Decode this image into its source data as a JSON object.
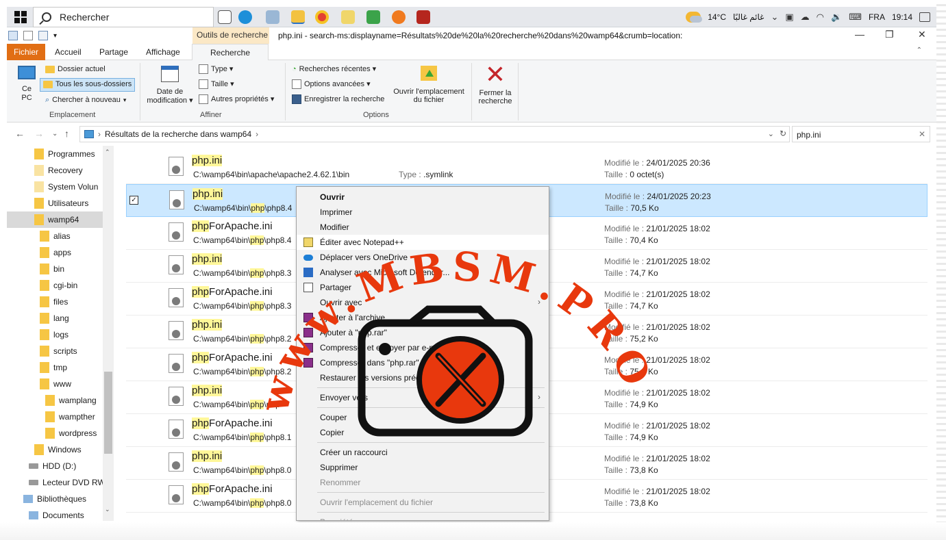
{
  "taskbar": {
    "search_placeholder": "Rechercher",
    "temperature": "14°C",
    "weather_text": "غائم غالبًا",
    "language": "FRA",
    "time": "19:14"
  },
  "titlebar": {
    "tools_tab": "Outils de recherche",
    "title": "php.ini - search-ms:displayname=Résultats%20de%20la%20recherche%20dans%20wamp64&crumb=location:"
  },
  "ribbon_tabs": [
    "Fichier",
    "Accueil",
    "Partage",
    "Affichage",
    "Recherche"
  ],
  "ribbon": {
    "this_pc": "Ce PC",
    "current_folder": "Dossier actuel",
    "all_subfolders": "Tous les sous-dossiers",
    "search_again": "Chercher à nouveau",
    "group_location": "Emplacement",
    "date_modified_1": "Date de",
    "date_modified_2": "modification",
    "type": "Type",
    "size": "Taille",
    "other_props": "Autres propriétés",
    "group_refine": "Affiner",
    "recent_searches": "Recherches récentes",
    "advanced_options": "Options avancées",
    "save_search": "Enregistrer la recherche",
    "open_location_1": "Ouvrir l'emplacement",
    "open_location_2": "du fichier",
    "group_options": "Options",
    "close_search_1": "Fermer la",
    "close_search_2": "recherche"
  },
  "address": {
    "path": "Résultats de la recherche dans wamp64",
    "search_value": "php.ini"
  },
  "nav": [
    {
      "label": "Programmes",
      "indent": 1,
      "kind": "folder"
    },
    {
      "label": "Recovery",
      "indent": 1,
      "kind": "pale"
    },
    {
      "label": "System Volun",
      "indent": 1,
      "kind": "pale"
    },
    {
      "label": "Utilisateurs",
      "indent": 1,
      "kind": "folder"
    },
    {
      "label": "wamp64",
      "indent": 1,
      "kind": "folder",
      "selected": true
    },
    {
      "label": "alias",
      "indent": 2,
      "kind": "folder"
    },
    {
      "label": "apps",
      "indent": 2,
      "kind": "folder"
    },
    {
      "label": "bin",
      "indent": 2,
      "kind": "folder"
    },
    {
      "label": "cgi-bin",
      "indent": 2,
      "kind": "folder"
    },
    {
      "label": "files",
      "indent": 2,
      "kind": "folder"
    },
    {
      "label": "lang",
      "indent": 2,
      "kind": "folder"
    },
    {
      "label": "logs",
      "indent": 2,
      "kind": "folder"
    },
    {
      "label": "scripts",
      "indent": 2,
      "kind": "folder"
    },
    {
      "label": "tmp",
      "indent": 2,
      "kind": "folder"
    },
    {
      "label": "www",
      "indent": 2,
      "kind": "folder"
    },
    {
      "label": "wamplang",
      "indent": 3,
      "kind": "folder"
    },
    {
      "label": "wampther",
      "indent": 3,
      "kind": "folder"
    },
    {
      "label": "wordpress",
      "indent": 3,
      "kind": "folder"
    },
    {
      "label": "Windows",
      "indent": 1,
      "kind": "folder"
    },
    {
      "label": "HDD (D:)",
      "indent": 0,
      "kind": "drive"
    },
    {
      "label": "Lecteur DVD RW",
      "indent": 0,
      "kind": "drive"
    },
    {
      "label": "Bibliothèques",
      "indent": -1,
      "kind": "lib"
    },
    {
      "label": "Documents",
      "indent": 0,
      "kind": "lib"
    }
  ],
  "labels": {
    "modified": "Modifié le : ",
    "size": "Taille : ",
    "type": "Type : "
  },
  "files": [
    {
      "name_hl": "php.ini",
      "name_rest": "",
      "path_a": "C:\\wamp64\\bin\\apache\\apache2.4.62.1\\bin",
      "path_php": "",
      "path_b": "",
      "type": ".symlink",
      "modified": "24/01/2025 20:36",
      "size": "0 octet(s)"
    },
    {
      "name_hl": "php.ini",
      "name_rest": "",
      "path_a": "C:\\wamp64\\bin\\",
      "path_php": "php",
      "path_b": "\\php8.4",
      "type": "",
      "modified": "24/01/2025 20:23",
      "size": "70,5 Ko",
      "selected": true
    },
    {
      "name_hl": "php",
      "name_rest": "ForApache.ini",
      "path_a": "C:\\wamp64\\bin\\",
      "path_php": "php",
      "path_b": "\\php8.4",
      "type": "",
      "modified": "21/01/2025 18:02",
      "size": "70,4 Ko"
    },
    {
      "name_hl": "php.ini",
      "name_rest": "",
      "path_a": "C:\\wamp64\\bin\\",
      "path_php": "php",
      "path_b": "\\php8.3",
      "type": "",
      "modified": "21/01/2025 18:02",
      "size": "74,7 Ko"
    },
    {
      "name_hl": "php",
      "name_rest": "ForApache.ini",
      "path_a": "C:\\wamp64\\bin\\",
      "path_php": "php",
      "path_b": "\\php8.3",
      "type": "",
      "modified": "21/01/2025 18:02",
      "size": "74,7 Ko"
    },
    {
      "name_hl": "php.ini",
      "name_rest": "",
      "path_a": "C:\\wamp64\\bin\\",
      "path_php": "php",
      "path_b": "\\php8.2",
      "type": "",
      "modified": "21/01/2025 18:02",
      "size": "75,2 Ko"
    },
    {
      "name_hl": "php",
      "name_rest": "ForApache.ini",
      "path_a": "C:\\wamp64\\bin\\",
      "path_php": "php",
      "path_b": "\\php8.2",
      "type": "",
      "modified": "21/01/2025 18:02",
      "size": "75,2 Ko"
    },
    {
      "name_hl": "php.ini",
      "name_rest": "",
      "path_a": "C:\\wamp64\\bin\\",
      "path_php": "php",
      "path_b": "\\php",
      "type": "",
      "modified": "21/01/2025 18:02",
      "size": "74,9 Ko"
    },
    {
      "name_hl": "php",
      "name_rest": "ForApache.ini",
      "path_a": "C:\\wamp64\\bin\\",
      "path_php": "php",
      "path_b": "\\php8.1",
      "type": "",
      "modified": "21/01/2025 18:02",
      "size": "74,9 Ko"
    },
    {
      "name_hl": "php.ini",
      "name_rest": "",
      "path_a": "C:\\wamp64\\bin\\",
      "path_php": "php",
      "path_b": "\\php8.0",
      "type": "",
      "modified": "21/01/2025 18:02",
      "size": "73,8 Ko"
    },
    {
      "name_hl": "php",
      "name_rest": "ForApache.ini",
      "path_a": "C:\\wamp64\\bin\\",
      "path_php": "php",
      "path_b": "\\php8.0",
      "type": "",
      "modified": "21/01/2025 18:02",
      "size": "73,8 Ko"
    }
  ],
  "context_menu": {
    "items": [
      {
        "label": "Ouvrir",
        "bold": true
      },
      {
        "label": "Imprimer"
      },
      {
        "label": "Modifier"
      },
      {
        "label": "Éditer avec Notepad++",
        "icon": "notepad-icon",
        "hover": true
      },
      {
        "label": "Déplacer vers OneDrive",
        "icon": "onedrive-icon"
      },
      {
        "label": "Analyser avec Microsoft Defender...",
        "icon": "defender-icon"
      },
      {
        "label": "Partager",
        "icon": "share-icon"
      },
      {
        "label": "Ouvrir avec",
        "submenu": true
      },
      {
        "label": "Ajouter à l'archive...",
        "icon": "winrar-icon"
      },
      {
        "label": "Ajouter à \"php.rar\"",
        "icon": "winrar-icon"
      },
      {
        "label": "Compresser et envoyer par e-mail...",
        "icon": "winrar-icon"
      },
      {
        "label": "Compresser dans \"php.rar\" et envoyer par e-mail",
        "icon": "winrar-icon"
      },
      {
        "label": "Restaurer les versions précédentes"
      },
      {
        "sep": true
      },
      {
        "label": "Envoyer vers",
        "submenu": true
      },
      {
        "sep": true
      },
      {
        "label": "Couper"
      },
      {
        "label": "Copier"
      },
      {
        "sep": true
      },
      {
        "label": "Créer un raccourci"
      },
      {
        "label": "Supprimer"
      },
      {
        "label": "Renommer",
        "disabled": true
      },
      {
        "sep": true
      },
      {
        "label": "Ouvrir l'emplacement du fichier",
        "disabled": true
      },
      {
        "sep": true
      },
      {
        "label": "Propriétés",
        "disabled": true
      }
    ]
  },
  "watermark": {
    "text": "www.MBSM.PRO",
    "color": "#e8380d"
  }
}
